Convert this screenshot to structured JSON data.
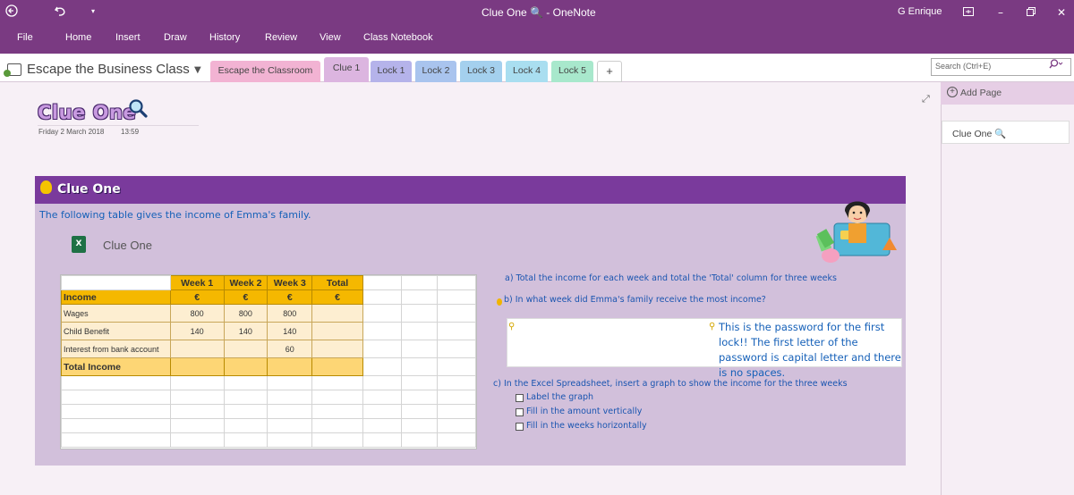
{
  "window": {
    "title": "Clue One 🔍  -  OneNote",
    "user": "G Enrique"
  },
  "ribbon": {
    "tabs": [
      "File",
      "Home",
      "Insert",
      "Draw",
      "History",
      "Review",
      "View",
      "Class Notebook"
    ]
  },
  "notebook": {
    "name": "Escape the Business Class",
    "sections": [
      "Escape the Classroom",
      "Clue 1",
      "Lock 1",
      "Lock 2",
      "Lock 3",
      "Lock 4",
      "Lock 5"
    ],
    "add_section": "+",
    "section_colors": [
      "#f2b3d3",
      "#dcb5e0",
      "#b5b3ea",
      "#a9c4ee",
      "#a4d0ee",
      "#a9def0",
      "#a8e8cc"
    ]
  },
  "search": {
    "placeholder": "Search (Ctrl+E)"
  },
  "page_list": {
    "add_page": "Add Page",
    "pages": [
      "Clue One 🔍"
    ]
  },
  "page": {
    "title": "Clue One",
    "date": "Friday 2 March 2018",
    "time": "13:59"
  },
  "card": {
    "heading": "Clue One",
    "intro": "The following table gives the income of Emma's family.",
    "file_name": "Clue One",
    "file_icon": "excel-icon"
  },
  "sheet": {
    "headers": [
      "Week 1",
      "Week 2",
      "Week 3",
      "Total"
    ],
    "currency_row": {
      "label": "Income",
      "values": [
        "€",
        "€",
        "€",
        "€"
      ]
    },
    "rows": [
      {
        "label": "Wages",
        "values": [
          "800",
          "800",
          "800",
          ""
        ]
      },
      {
        "label": "Child Benefit",
        "values": [
          "140",
          "140",
          "140",
          ""
        ]
      },
      {
        "label": "Interest from bank account",
        "values": [
          "",
          "",
          "60",
          ""
        ]
      }
    ],
    "total_label": "Total Income"
  },
  "questions": {
    "a": "a) Total the income for each week and total the 'Total' column for three weeks",
    "b": "b) In what week did Emma's family receive the most income?",
    "password_note": "This is the password for the first lock!! The first letter of the password is capital letter and there is no spaces.",
    "c": "c) In the Excel Spreadsheet, insert a graph to show the income for the three weeks",
    "tasks": [
      "Label the graph",
      "Fill in the amount vertically",
      "Fill in the weeks horizontally"
    ]
  },
  "colors": {
    "accent": "#7a3a82",
    "card": "#d2c0db",
    "header_orange": "#f5b800",
    "question_blue": "#1a55b0"
  }
}
